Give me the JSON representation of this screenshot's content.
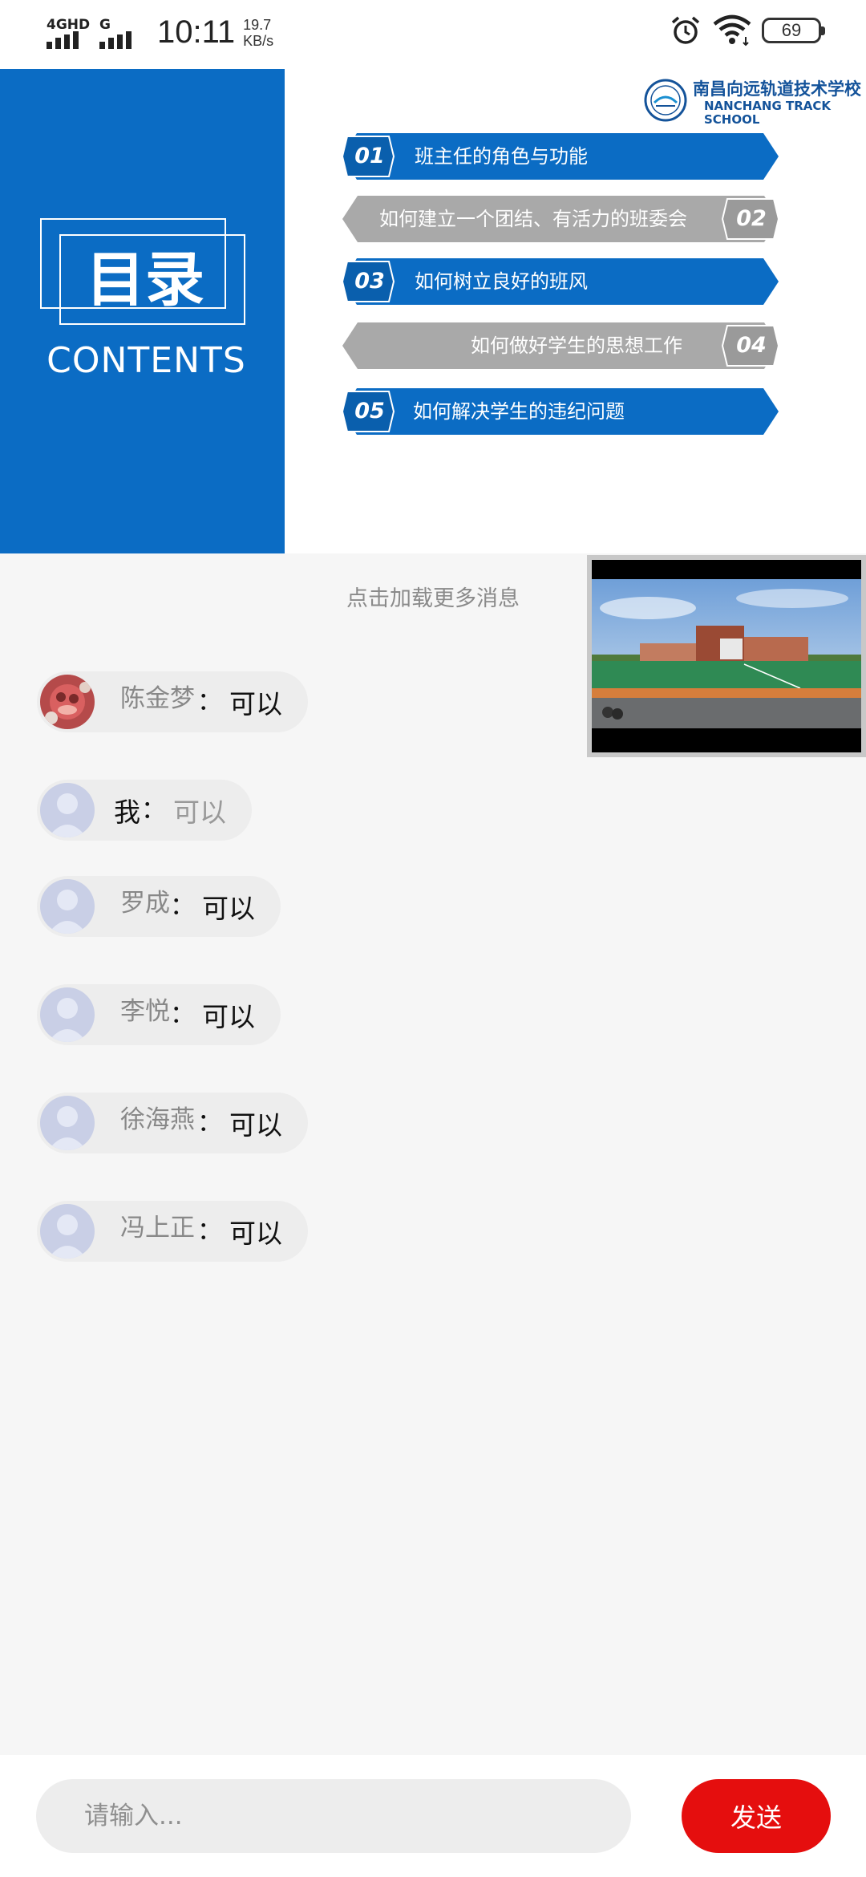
{
  "status_bar": {
    "network_4g": "4GHD",
    "network_g": "G",
    "time": "10:11",
    "speed_value": "19.7",
    "speed_unit": "KB/s",
    "battery": "69"
  },
  "slide": {
    "title": "目录",
    "subtitle": "CONTENTS",
    "school_name_cn": "南昌向远轨道技术学校",
    "school_name_en_1": "NANCHANG TRACK",
    "school_name_en_2": "SCHOOL",
    "items": [
      {
        "num": "01",
        "text": "班主任的角色与功能",
        "color": "#0b6cc4"
      },
      {
        "num": "02",
        "text": "如何建立一个团结、有活力的班委会",
        "color": "#a9a9a9"
      },
      {
        "num": "03",
        "text": "如何树立良好的班风",
        "color": "#0b6cc4"
      },
      {
        "num": "04",
        "text": "如何做好学生的思想工作",
        "color": "#a9a9a9"
      },
      {
        "num": "05",
        "text": "如何解决学生的违纪问题",
        "color": "#0b6cc4"
      }
    ]
  },
  "chat": {
    "load_more": "点击加载更多消息",
    "messages": [
      {
        "name": "陈金梦",
        "colon": "：",
        "text": "可以"
      },
      {
        "name": "我",
        "colon": "：",
        "text": "可以"
      },
      {
        "name": "罗成",
        "colon": "：",
        "text": "可以"
      },
      {
        "name": "李悦",
        "colon": "：",
        "text": "可以"
      },
      {
        "name": "徐海燕",
        "colon": "：",
        "text": "可以"
      },
      {
        "name": "冯上正",
        "colon": "：",
        "text": "可以"
      }
    ]
  },
  "input": {
    "placeholder": "请输入...",
    "send_label": "发送"
  },
  "colors": {
    "brand_blue": "#0b6cc4",
    "send_red": "#e50e0e"
  }
}
